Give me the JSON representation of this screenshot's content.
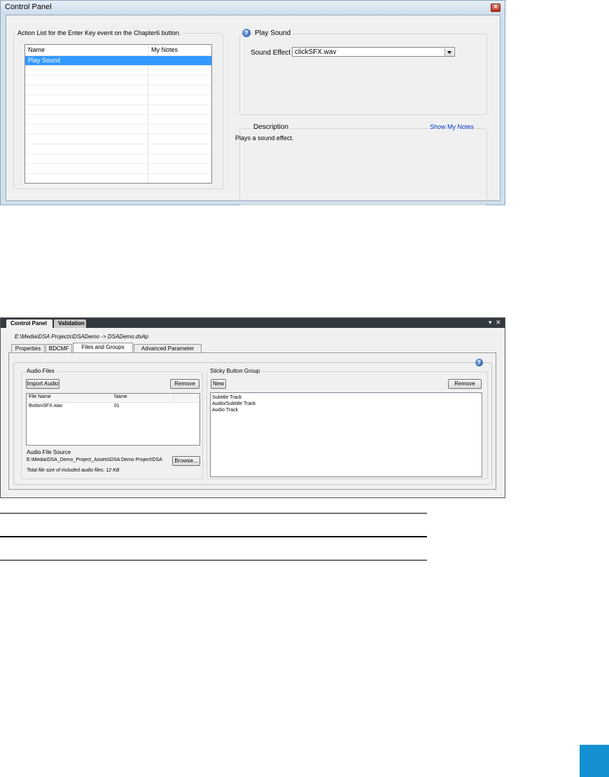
{
  "window1": {
    "title": "Control Panel",
    "close_glyph": "x",
    "action_list": {
      "legend": "Action List for the Enter Key event on the Chapter6 button.",
      "columns": [
        "Name",
        "My Notes"
      ],
      "rows": [
        {
          "name": "Play Sound",
          "notes": ""
        }
      ],
      "selected_color": "#3399ff"
    },
    "play_sound": {
      "legend": "Play Sound",
      "help_icon": "help-icon",
      "sound_effect_label": "Sound Effect",
      "sound_effect_value": "clickSFX.wav"
    },
    "description": {
      "legend": "Description",
      "show_notes_link": "Show My Notes",
      "text": "Plays a sound effect.",
      "link_color": "#0033cc"
    }
  },
  "window2": {
    "dock_tabs": [
      "Control Panel",
      "Validation"
    ],
    "pin_glyph": "▾",
    "close_glyph": "✕",
    "path": "E:\\Media\\DSA Projects\\DSADemo -> DSADemo.dsAp",
    "property_tabs": [
      "Properties",
      "BDCMF",
      "Files and Groups",
      "Advanced Parameter"
    ],
    "active_tab": "Files and Groups",
    "help_icon": "help-icon",
    "audio_files": {
      "legend": "Audio Files",
      "import_button": "Import Audio",
      "remove_button": "Remove",
      "columns": [
        "File Name",
        "Name"
      ],
      "rows": [
        {
          "file": "ButtonSFX.wav",
          "name": "01"
        }
      ],
      "source_label": "Audio File Source",
      "source_path": "E:\\Media\\DSA_Demo_Project_Assets\\DSA Demo Project\\DSA",
      "browse_button": "Browse...",
      "total_size": "Total file size of included audio files: 12 KB"
    },
    "sticky_group": {
      "legend": "Sticky Button Group",
      "new_button": "New",
      "remove_button": "Remove",
      "items": [
        "Subtitle Track",
        "Audio/Subtitle Track",
        "Audio Track"
      ]
    }
  },
  "accent_color": "#1591d3"
}
